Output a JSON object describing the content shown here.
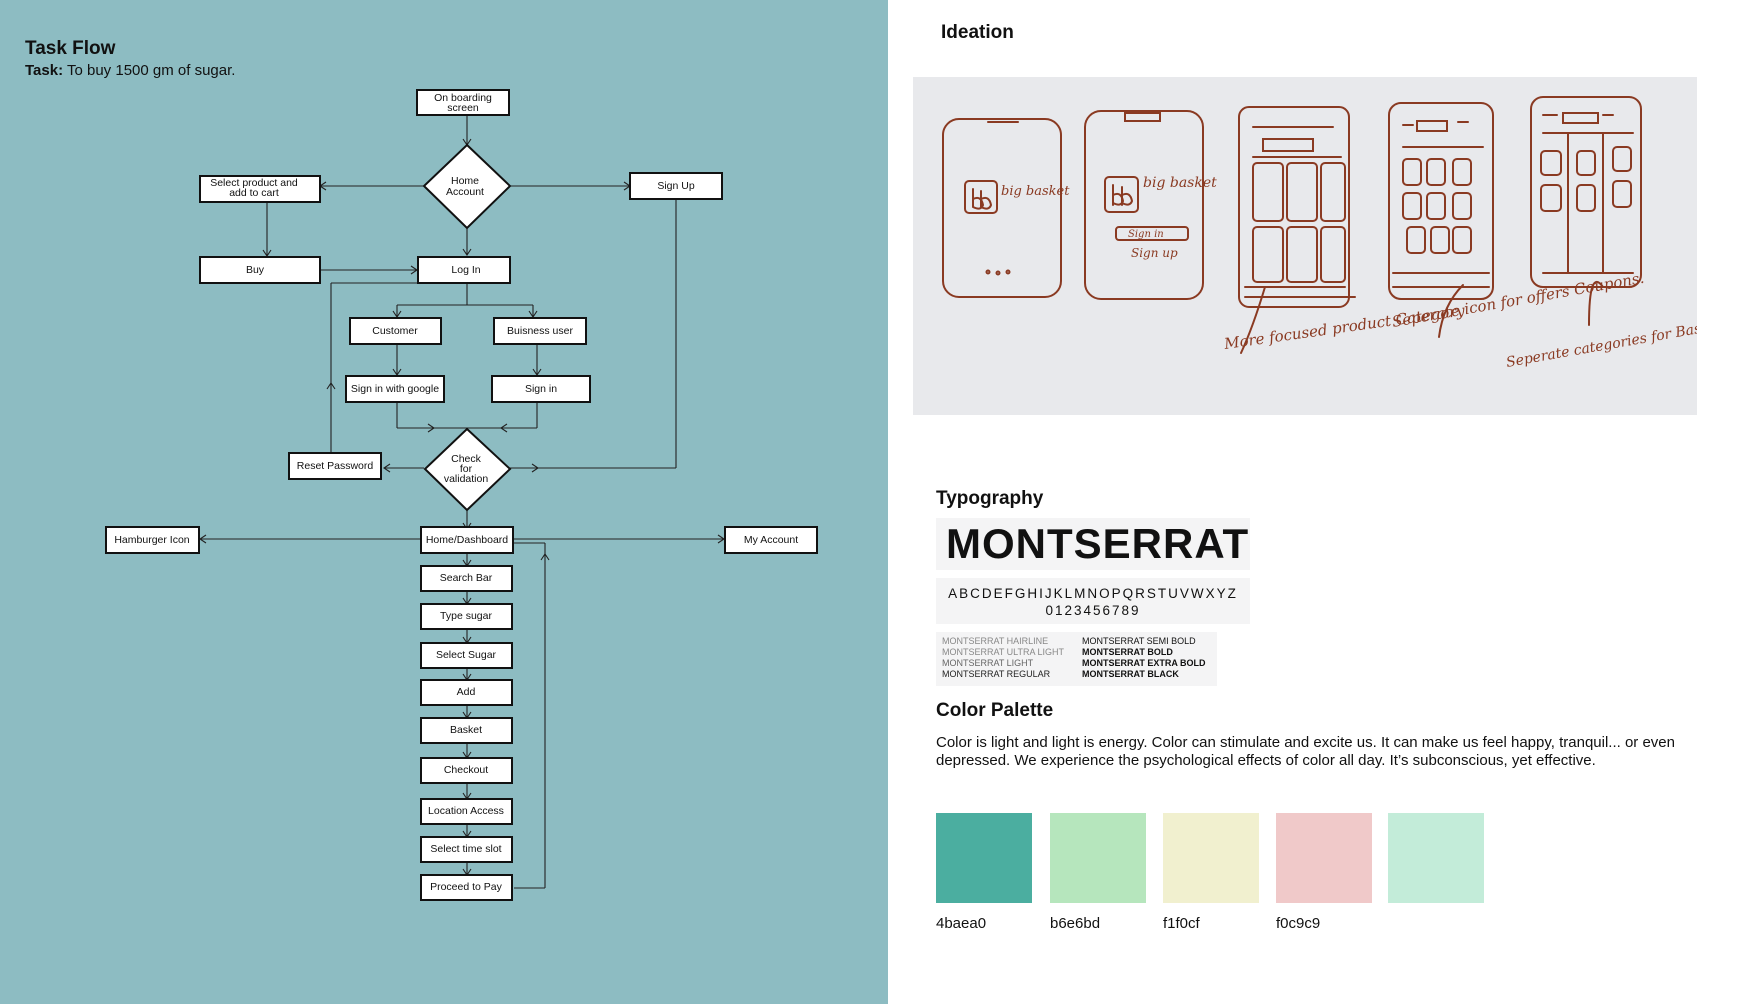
{
  "task_flow": {
    "title": "Task Flow",
    "task_label": "Task:",
    "task_text": "To buy 1500 gm of sugar.",
    "nodes": {
      "onboarding": [
        "On boarding",
        "screen"
      ],
      "home_account": [
        "Home",
        "Account"
      ],
      "select_product": [
        "Select product and",
        "add to cart"
      ],
      "sign_up": "Sign Up",
      "buy": "Buy",
      "log_in": "Log In",
      "customer": "Customer",
      "business_user": "Buisness user",
      "sign_in_google": "Sign in with google",
      "sign_in": "Sign in",
      "reset_password": "Reset Password",
      "check_validation": [
        "Check",
        "for",
        "validation"
      ],
      "hamburger_icon": "Hamburger Icon",
      "home_dashboard": "Home/Dashboard",
      "my_account": "My Account",
      "search_bar": "Search Bar",
      "type_sugar": "Type sugar",
      "select_sugar": "Select Sugar",
      "add": "Add",
      "basket": "Basket",
      "checkout": "Checkout",
      "location_access": "Location Access",
      "select_time_slot": "Select time slot",
      "proceed_to_pay": "Proceed to Pay"
    }
  },
  "ideation": {
    "title": "Ideation",
    "sketch_notes": [
      "big basket",
      "Sign in",
      "Sign up",
      "More focused product Category",
      "Seperate icon for offers Coupons.",
      "Seperate categories for Basket."
    ]
  },
  "typography": {
    "title": "Typography",
    "font_name": "MONTSERRAT",
    "alphabet": "ABCDEFGHIJKLMNOPQRSTUVWXYZ",
    "digits": "0123456789",
    "weights_left": [
      "MONTSERRAT HAIRLINE",
      "MONTSERRAT ULTRA LIGHT",
      "MONTSERRAT LIGHT",
      "MONTSERRAT REGULAR"
    ],
    "weights_right": [
      "MONTSERRAT SEMI BOLD",
      "MONTSERRAT BOLD",
      "MONTSERRAT EXTRA BOLD",
      "MONTSERRAT BLACK"
    ]
  },
  "palette": {
    "title": "Color Palette",
    "description": "Color is light and light is energy. Color can stimulate and excite us. It can make us feel happy, tranquil... or even depressed. We experience the psychological effects of color all day. It’s subconscious, yet effective.",
    "swatches": [
      {
        "label": "4baea0",
        "color": "#4baea0"
      },
      {
        "label": "b6e6bd",
        "color": "#b6e6bd"
      },
      {
        "label": "f1f0cf",
        "color": "#f1f0cf"
      },
      {
        "label": "f0c9c9",
        "color": "#f0c9c9"
      },
      {
        "label": "",
        "color": "#c3ecd9"
      }
    ]
  }
}
